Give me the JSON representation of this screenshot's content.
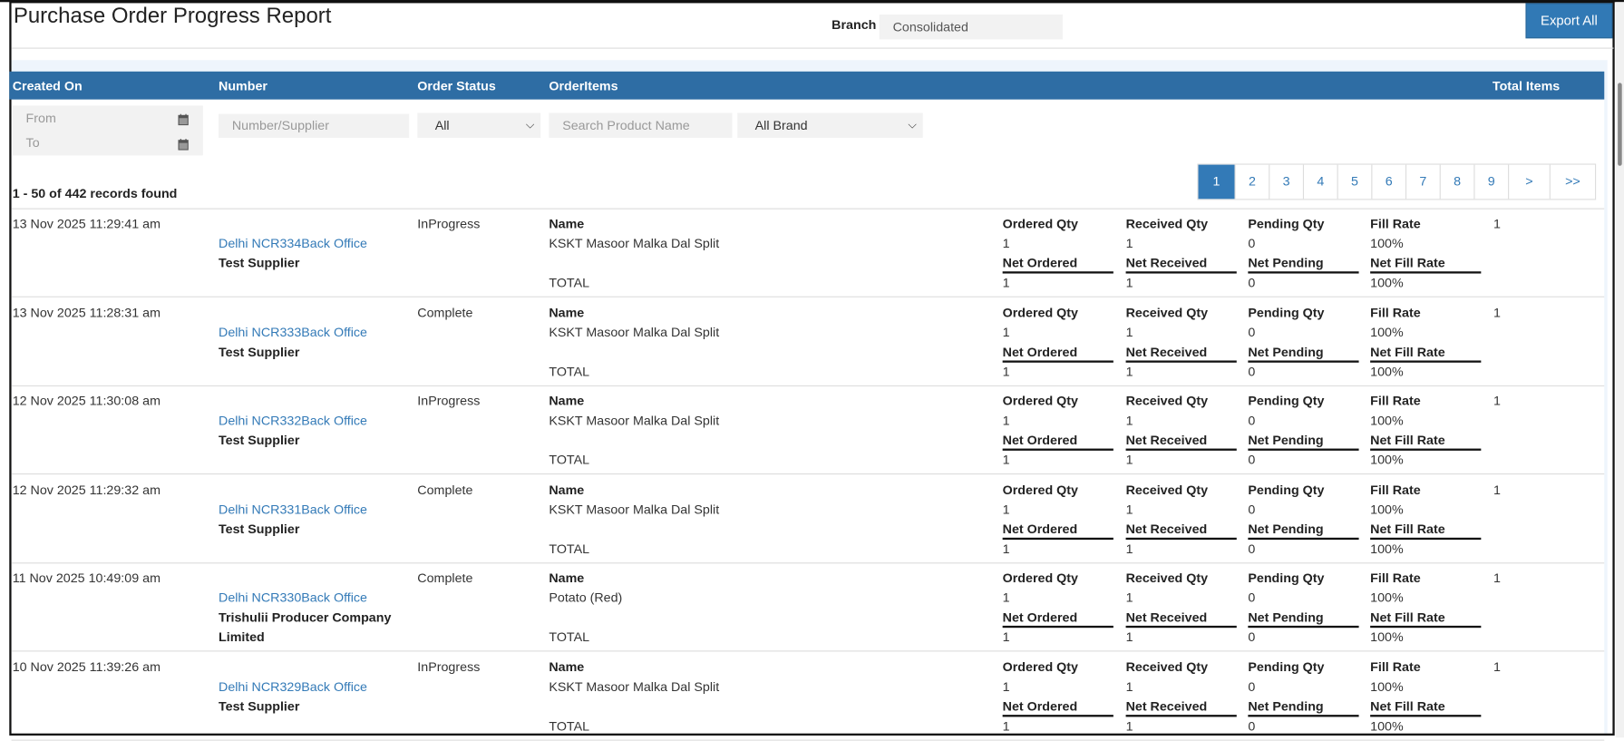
{
  "header": {
    "title": "Purchase Order Progress Report",
    "branch_label": "Branch",
    "branch_value": "Consolidated",
    "export_label": "Export All"
  },
  "columns": {
    "created_on": "Created On",
    "number": "Number",
    "order_status": "Order Status",
    "order_items": "OrderItems",
    "total_items": "Total Items"
  },
  "filters": {
    "from_placeholder": "From",
    "to_placeholder": "To",
    "number_placeholder": "Number/Supplier",
    "status_value": "All",
    "product_placeholder": "Search Product Name",
    "brand_value": "All Brand"
  },
  "records_text": "1 - 50 of 442 records found",
  "pagination": {
    "pages": [
      "1",
      "2",
      "3",
      "4",
      "5",
      "6",
      "7",
      "8",
      "9"
    ],
    "current": "1",
    "next": ">",
    "last": ">>"
  },
  "labels": {
    "name": "Name",
    "total": "TOTAL",
    "ordered_qty": "Ordered Qty",
    "received_qty": "Received Qty",
    "pending_qty": "Pending Qty",
    "fill_rate": "Fill Rate",
    "net_ordered": "Net Ordered",
    "net_received": "Net Received",
    "net_pending": "Net Pending",
    "net_fill_rate": "Net Fill Rate"
  },
  "rows": [
    {
      "created": "13 Nov 2025 11:29:41 am",
      "number": "Delhi NCR334Back Office",
      "supplier": "Test Supplier",
      "status": "InProgress",
      "product": "KSKT Masoor Malka Dal Split",
      "ordered": "1",
      "received": "1",
      "pending": "0",
      "fill_rate": "100%",
      "net_ordered": "1",
      "net_received": "1",
      "net_pending": "0",
      "net_fill_rate": "100%",
      "total_items": "1"
    },
    {
      "created": "13 Nov 2025 11:28:31 am",
      "number": "Delhi NCR333Back Office",
      "supplier": "Test Supplier",
      "status": "Complete",
      "product": "KSKT Masoor Malka Dal Split",
      "ordered": "1",
      "received": "1",
      "pending": "0",
      "fill_rate": "100%",
      "net_ordered": "1",
      "net_received": "1",
      "net_pending": "0",
      "net_fill_rate": "100%",
      "total_items": "1"
    },
    {
      "created": "12 Nov 2025 11:30:08 am",
      "number": "Delhi NCR332Back Office",
      "supplier": "Test Supplier",
      "status": "InProgress",
      "product": "KSKT Masoor Malka Dal Split",
      "ordered": "1",
      "received": "1",
      "pending": "0",
      "fill_rate": "100%",
      "net_ordered": "1",
      "net_received": "1",
      "net_pending": "0",
      "net_fill_rate": "100%",
      "total_items": "1"
    },
    {
      "created": "12 Nov 2025 11:29:32 am",
      "number": "Delhi NCR331Back Office",
      "supplier": "Test Supplier",
      "status": "Complete",
      "product": "KSKT Masoor Malka Dal Split",
      "ordered": "1",
      "received": "1",
      "pending": "0",
      "fill_rate": "100%",
      "net_ordered": "1",
      "net_received": "1",
      "net_pending": "0",
      "net_fill_rate": "100%",
      "total_items": "1"
    },
    {
      "created": "11 Nov 2025 10:49:09 am",
      "number": "Delhi NCR330Back Office",
      "supplier": "Trishulii Producer Company Limited",
      "status": "Complete",
      "product": "Potato (Red)",
      "ordered": "1",
      "received": "1",
      "pending": "0",
      "fill_rate": "100%",
      "net_ordered": "1",
      "net_received": "1",
      "net_pending": "0",
      "net_fill_rate": "100%",
      "total_items": "1"
    },
    {
      "created": "10 Nov 2025 11:39:26 am",
      "number": "Delhi NCR329Back Office",
      "supplier": "Test Supplier",
      "status": "InProgress",
      "product": "KSKT Masoor Malka Dal Split",
      "ordered": "1",
      "received": "1",
      "pending": "0",
      "fill_rate": "100%",
      "net_ordered": "1",
      "net_received": "1",
      "net_pending": "0",
      "net_fill_rate": "100%",
      "total_items": "1"
    }
  ],
  "colors": {
    "header_bg": "#2e6da4",
    "link": "#337ab7",
    "accent": "#3179b5"
  }
}
